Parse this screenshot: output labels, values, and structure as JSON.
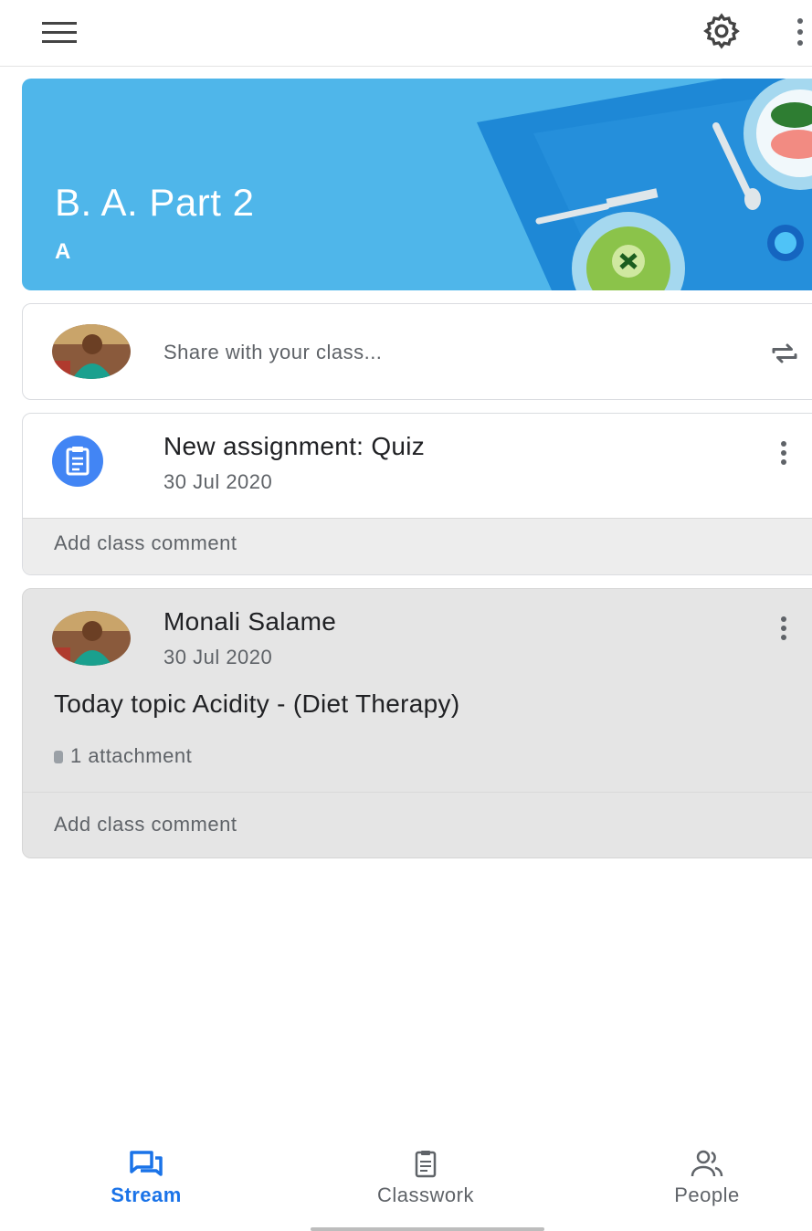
{
  "appbar": {
    "menu_icon": "menu-icon",
    "settings_icon": "gear-icon",
    "overflow_icon": "more-vert-icon"
  },
  "banner": {
    "class_name": "B. A. Part 2",
    "section": "A",
    "theme_colour": "#4fb6ea"
  },
  "share": {
    "placeholder": "Share with your class...",
    "repost_icon": "repost-icon"
  },
  "assignment": {
    "title": "New assignment: Quiz",
    "date": "30 Jul 2020",
    "comment_placeholder": "Add class comment",
    "icon": "assignment-icon"
  },
  "post": {
    "author": "Monali Salame",
    "date": "30 Jul 2020",
    "body": "Today topic  Acidity - (Diet Therapy)",
    "attachments": "1 attachment",
    "comment_placeholder": "Add class comment"
  },
  "bottom_nav": {
    "items": [
      {
        "label": "Stream",
        "icon": "stream-icon",
        "active": true
      },
      {
        "label": "Classwork",
        "icon": "classwork-icon",
        "active": false
      },
      {
        "label": "People",
        "icon": "people-icon",
        "active": false
      }
    ],
    "active_colour": "#1a73e8"
  }
}
